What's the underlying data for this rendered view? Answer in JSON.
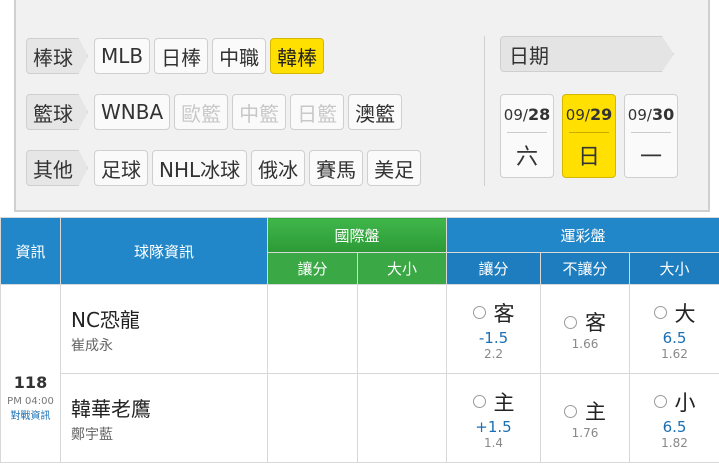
{
  "sports": [
    {
      "category": "棒球",
      "items": [
        {
          "label": "MLB",
          "state": "normal"
        },
        {
          "label": "日棒",
          "state": "normal"
        },
        {
          "label": "中職",
          "state": "normal"
        },
        {
          "label": "韓棒",
          "state": "active"
        }
      ]
    },
    {
      "category": "籃球",
      "items": [
        {
          "label": "WNBA",
          "state": "normal"
        },
        {
          "label": "歐籃",
          "state": "disabled"
        },
        {
          "label": "中籃",
          "state": "disabled"
        },
        {
          "label": "日籃",
          "state": "disabled"
        },
        {
          "label": "澳籃",
          "state": "normal"
        }
      ]
    },
    {
      "category": "其他",
      "items": [
        {
          "label": "足球",
          "state": "normal"
        },
        {
          "label": "NHL冰球",
          "state": "normal"
        },
        {
          "label": "俄冰",
          "state": "normal"
        },
        {
          "label": "賽馬",
          "state": "normal"
        },
        {
          "label": "美足",
          "state": "normal"
        }
      ]
    }
  ],
  "date_panel": {
    "title": "日期",
    "days": [
      {
        "month": "09/",
        "day": "28",
        "weekday": "六",
        "active": false
      },
      {
        "month": "09/",
        "day": "29",
        "weekday": "日",
        "active": true
      },
      {
        "month": "09/",
        "day": "30",
        "weekday": "一",
        "active": false
      }
    ]
  },
  "table": {
    "headers": {
      "info": "資訊",
      "team": "球隊資訊",
      "intl": "國際盤",
      "lottery": "運彩盤",
      "intl_spread": "讓分",
      "intl_total": "大小",
      "lot_spread": "讓分",
      "lot_moneyline": "不讓分",
      "lot_total": "大小"
    },
    "game": {
      "number": "118",
      "time": "PM 04:00",
      "link": "對戰資訊"
    },
    "rows": [
      {
        "team": "NC恐龍",
        "pitcher": "崔成永",
        "spread": {
          "label": "客",
          "line": "-1.5",
          "odds": "2.2"
        },
        "moneyline": {
          "label": "客",
          "odds": "1.66"
        },
        "total": {
          "label": "大",
          "line": "6.5",
          "odds": "1.62"
        }
      },
      {
        "team": "韓華老鷹",
        "pitcher": "鄭宇藍",
        "spread": {
          "label": "主",
          "line": "+1.5",
          "odds": "1.4"
        },
        "moneyline": {
          "label": "主",
          "odds": "1.76"
        },
        "total": {
          "label": "小",
          "line": "6.5",
          "odds": "1.82"
        }
      }
    ]
  }
}
